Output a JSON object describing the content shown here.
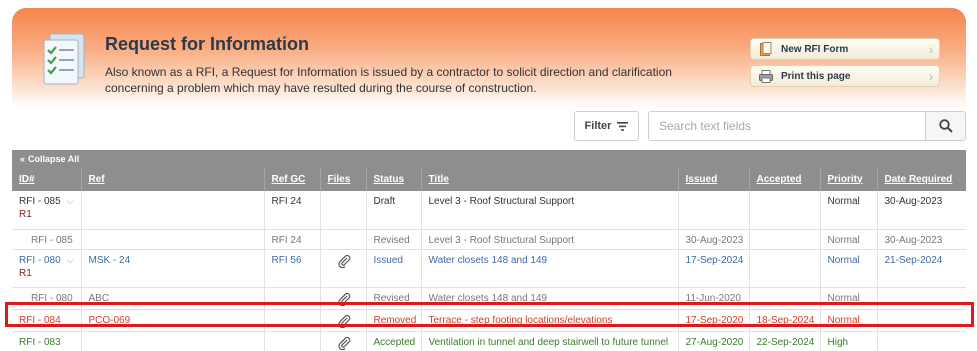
{
  "banner": {
    "title": "Request for Information",
    "description": "Also known as a RFI, a Request for Information is issued by a contractor to solicit direction and clarification concerning a problem which may have resulted during the course of construction.",
    "icon": "checklist-document-icon"
  },
  "actions": {
    "new_rfi": "New RFI Form",
    "print": "Print this page"
  },
  "toolbar": {
    "filter_label": "Filter",
    "search_placeholder": "Search text fields"
  },
  "grid": {
    "collapse_label": "Collapse All",
    "columns": [
      "ID#",
      "Ref",
      "Ref GC",
      "Files",
      "Status",
      "Title",
      "Issued",
      "Accepted",
      "Priority",
      "Date Required"
    ],
    "rows": [
      {
        "id": "RFI - 085",
        "rev": "R1",
        "ref": "",
        "ref_gc": "RFI 24",
        "files": false,
        "status": "Draft",
        "title": "Level 3 - Roof Structural Support",
        "issued": "",
        "accepted": "",
        "priority": "Normal",
        "date_required": "30-Aug-2023"
      },
      {
        "id": "RFI - 085",
        "ref": "",
        "ref_gc": "RFI 24",
        "files": false,
        "status": "Revised",
        "title": "Level 3 - Roof Structural Support",
        "issued": "30-Aug-2023",
        "accepted": "",
        "priority": "Normal",
        "date_required": "30-Aug-2023"
      },
      {
        "id": "RFI - 080",
        "rev": "R1",
        "ref": "MSK - 24",
        "ref_gc": "RFI 56",
        "files": true,
        "status": "Issued",
        "title": "Water closets 148 and 149",
        "issued": "17-Sep-2024",
        "accepted": "",
        "priority": "Normal",
        "date_required": "21-Sep-2024"
      },
      {
        "id": "RFI - 080",
        "ref": "ABC",
        "ref_gc": "",
        "files": true,
        "status": "Revised",
        "title": "Water closets 148 and 149",
        "issued": "11-Jun-2020",
        "accepted": "",
        "priority": "Normal",
        "date_required": ""
      },
      {
        "id": "RFI - 084",
        "ref": "PCO-069",
        "ref_gc": "",
        "files": true,
        "status": "Removed",
        "title": "Terrace - step footing locations/elevations",
        "issued": "17-Sep-2020",
        "accepted": "18-Sep-2024",
        "priority": "Normal",
        "date_required": ""
      },
      {
        "id": "RFI - 083",
        "ref": "",
        "ref_gc": "",
        "files": true,
        "status": "Accepted",
        "title": "Ventilation in tunnel and deep stairwell to future tunnel",
        "issued": "27-Aug-2020",
        "accepted": "22-Sep-2024",
        "priority": "High",
        "date_required": ""
      }
    ]
  },
  "colors": {
    "banner_orange": "#f5854e",
    "header_grey": "#8e8e8e",
    "status_blue": "#3e6aa6",
    "status_red": "#d83b27",
    "status_green": "#3a7d2c",
    "highlight_red": "#e0171b"
  }
}
